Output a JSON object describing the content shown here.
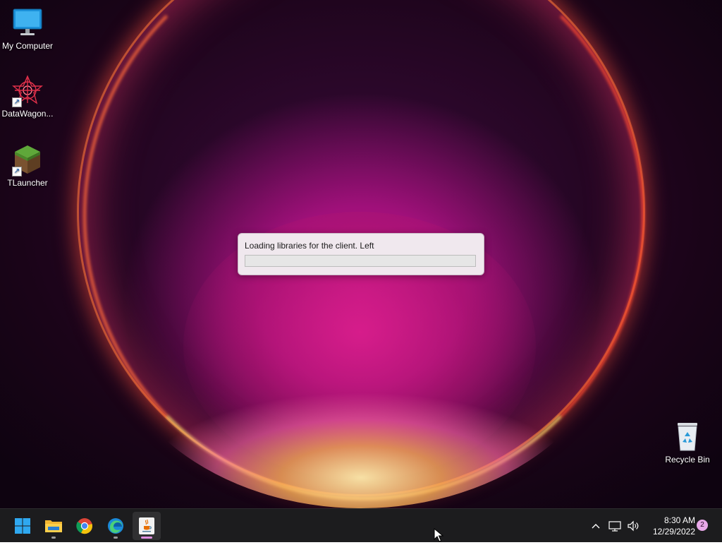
{
  "desktop": {
    "icons": [
      {
        "label": "My Computer",
        "icon": "monitor-icon"
      },
      {
        "label": "DataWagon...",
        "icon": "datawagon-icon",
        "shortcut": true
      },
      {
        "label": "TLauncher",
        "icon": "grass-block-icon",
        "shortcut": true
      },
      {
        "label": "Recycle Bin",
        "icon": "recycle-bin-icon"
      }
    ]
  },
  "loader": {
    "message": "Loading libraries for the client. Left",
    "progress_percent": 0
  },
  "taskbar": {
    "apps": [
      {
        "name": "start",
        "icon": "windows-start-icon"
      },
      {
        "name": "file-explorer",
        "icon": "folder-icon",
        "running": true
      },
      {
        "name": "chrome",
        "icon": "chrome-icon",
        "running": false
      },
      {
        "name": "edge",
        "icon": "edge-icon",
        "running": true
      },
      {
        "name": "java",
        "icon": "java-icon",
        "running": true,
        "active": true
      }
    ],
    "tray": {
      "time": "8:30 AM",
      "date": "12/29/2022",
      "notification_count": "2"
    }
  },
  "colors": {
    "progress_fill": "#06b025",
    "active_indicator": "#e08ee0",
    "taskbar_bg": "#1c1c1e"
  }
}
